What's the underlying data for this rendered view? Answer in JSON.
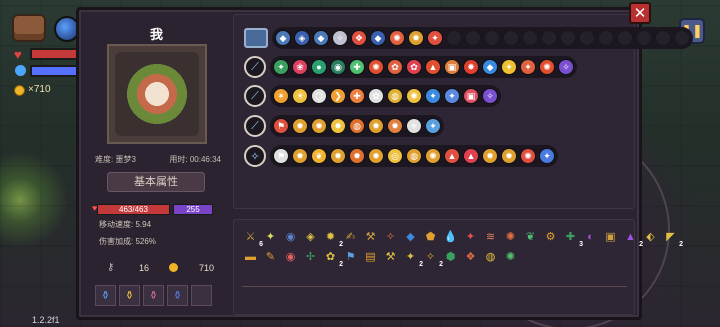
{
  "hud": {
    "gold": "×710",
    "version": "1.2.2f1"
  },
  "buttons": {
    "close": "✕",
    "pause": "❚❚"
  },
  "character": {
    "name": "我",
    "difficulty": "难度: 噩梦3",
    "time": "用时: 00:46:34",
    "attr_title": "基本属性",
    "hp": "463/463",
    "mp": "255",
    "move_speed": "移动速度: 5.94",
    "damage_bonus": "伤害加成: 526%",
    "keys": "16",
    "coins": "710"
  },
  "weapons": {
    "row1": {
      "colors": [
        "#4a7ab8",
        "#3a5fb0",
        "#4a7ab8",
        "#c0c0d0",
        "#e05040",
        "#3a5fb0",
        "#e06040",
        "#e0a030",
        "#e05040"
      ],
      "glyphs": [
        "◆",
        "◈",
        "◆",
        "✧",
        "❖",
        "◆",
        "✺",
        "✹",
        "✦"
      ],
      "empty": 13
    },
    "row2": {
      "colors": [
        "#3aa060",
        "#e04060",
        "#2aa070",
        "#2a8060",
        "#50c070",
        "#e05030",
        "#e06040",
        "#e04050",
        "#e05030",
        "#e08040",
        "#e04030",
        "#3a8ae0",
        "#f0c030",
        "#e06040",
        "#e05030",
        "#7a50d0"
      ],
      "glyphs": [
        "✦",
        "❀",
        "●",
        "◉",
        "✚",
        "✺",
        "✿",
        "✿",
        "▲",
        "▣",
        "✸",
        "◆",
        "✦",
        "✦",
        "✺",
        "✧"
      ]
    },
    "row3": {
      "colors": [
        "#f0a030",
        "#f0c040",
        "#e0e0e0",
        "#f0a030",
        "#f08040",
        "#e0e0e0",
        "#e0b030",
        "#f0c040",
        "#3a8ae0",
        "#5a8ae0",
        "#e05060",
        "#7a50d0"
      ],
      "glyphs": [
        "✶",
        "☀",
        "⬡",
        "❯",
        "✚",
        "✿",
        "◍",
        "✺",
        "✦",
        "✦",
        "▣",
        "✧"
      ]
    },
    "row4": {
      "colors": [
        "#e05040",
        "#e0a030",
        "#e0a030",
        "#f0c040",
        "#e07030",
        "#e0a030",
        "#e08040",
        "#e0e0e0",
        "#5aa0e0"
      ],
      "glyphs": [
        "⚑",
        "✹",
        "✹",
        "✸",
        "◍",
        "✹",
        "✹",
        "✳",
        "✦"
      ]
    },
    "row5": {
      "colors": [
        "#e0e0e0",
        "#e0a030",
        "#f0b030",
        "#e0a030",
        "#e07030",
        "#e0a030",
        "#f0c040",
        "#e0a030",
        "#e0a030",
        "#e05040",
        "#e04050",
        "#e0a030",
        "#e0a030",
        "#e05040",
        "#4a7ae0"
      ],
      "glyphs": [
        "⚑",
        "✹",
        "❦",
        "✹",
        "✹",
        "✹",
        "◎",
        "◍",
        "✺",
        "▲",
        "▲",
        "✹",
        "✹",
        "✺",
        "✦"
      ]
    }
  },
  "inventory": {
    "row1": [
      {
        "color": "#d0a040",
        "glyph": "⚔",
        "count": "6"
      },
      {
        "color": "#e0e060",
        "glyph": "✦",
        "count": ""
      },
      {
        "color": "#5a80d0",
        "glyph": "◉",
        "count": ""
      },
      {
        "color": "#e0c040",
        "glyph": "◈",
        "count": ""
      },
      {
        "color": "#e0c040",
        "glyph": "✹",
        "count": "2"
      },
      {
        "color": "#d0a040",
        "glyph": "✍",
        "count": ""
      },
      {
        "color": "#d0a040",
        "glyph": "⚒",
        "count": ""
      },
      {
        "color": "#e07040",
        "glyph": "✧",
        "count": ""
      },
      {
        "color": "#3a8ae0",
        "glyph": "◆",
        "count": ""
      },
      {
        "color": "#e0a030",
        "glyph": "⬟",
        "count": ""
      },
      {
        "color": "#4a80e0",
        "glyph": "💧",
        "count": ""
      },
      {
        "color": "#e05050",
        "glyph": "✦",
        "count": ""
      },
      {
        "color": "#e08060",
        "glyph": "≋",
        "count": ""
      },
      {
        "color": "#e07040",
        "glyph": "✺",
        "count": ""
      },
      {
        "color": "#50c070",
        "glyph": "❦",
        "count": ""
      },
      {
        "color": "#e0a030",
        "glyph": "⚙",
        "count": ""
      },
      {
        "color": "#3aa060",
        "glyph": "✚",
        "count": "3"
      },
      {
        "color": "#a050e0",
        "glyph": "◐",
        "count": ""
      },
      {
        "color": "#d0a040",
        "glyph": "▣",
        "count": ""
      },
      {
        "color": "#a050e0",
        "glyph": "▲",
        "count": "2"
      },
      {
        "color": "#e0c040",
        "glyph": "⬖",
        "count": ""
      },
      {
        "color": "#e0c040",
        "glyph": "◤",
        "count": "2"
      }
    ],
    "row2": [
      {
        "color": "#e0a030",
        "glyph": "▬",
        "count": ""
      },
      {
        "color": "#e0a030",
        "glyph": "✎",
        "count": ""
      },
      {
        "color": "#e06060",
        "glyph": "◉",
        "count": ""
      },
      {
        "color": "#3aa060",
        "glyph": "✢",
        "count": ""
      },
      {
        "color": "#e0c040",
        "glyph": "✿",
        "count": "2"
      },
      {
        "color": "#5aa0e0",
        "glyph": "⚑",
        "count": ""
      },
      {
        "color": "#e0a030",
        "glyph": "▤",
        "count": ""
      },
      {
        "color": "#e0c040",
        "glyph": "⚒",
        "count": ""
      },
      {
        "color": "#e0c040",
        "glyph": "✦",
        "count": "2"
      },
      {
        "color": "#d0a040",
        "glyph": "✧",
        "count": "2"
      },
      {
        "color": "#3aa060",
        "glyph": "⬢",
        "count": ""
      },
      {
        "color": "#e07040",
        "glyph": "❖",
        "count": ""
      },
      {
        "color": "#e0c040",
        "glyph": "◍",
        "count": ""
      },
      {
        "color": "#50c070",
        "glyph": "✺",
        "count": ""
      }
    ]
  }
}
